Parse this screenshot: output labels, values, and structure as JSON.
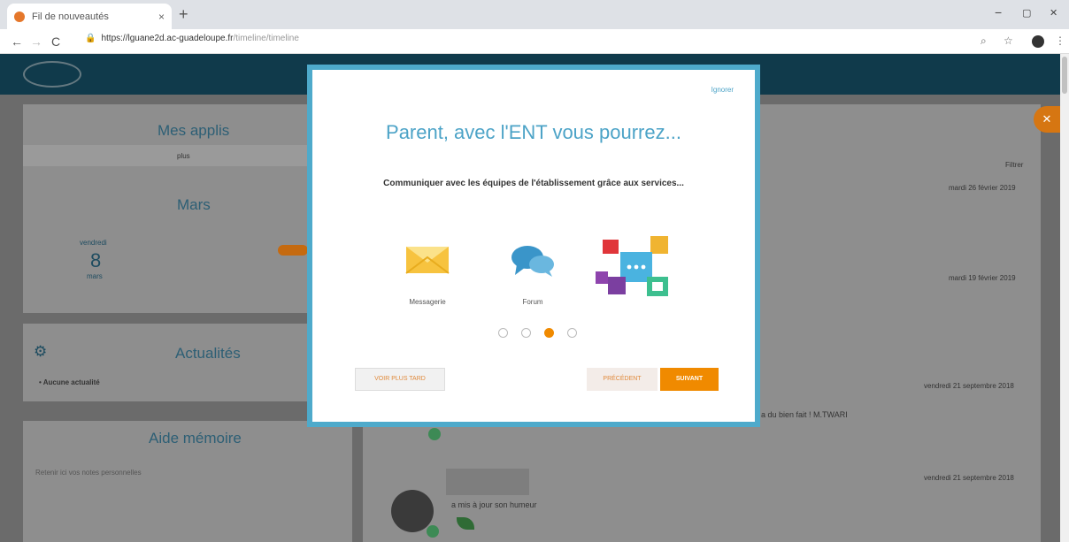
{
  "browser": {
    "tab_title": "Fil de nouveautés",
    "tab_close": "×",
    "new_tab": "+",
    "url_host": "https://lguane2d.ac-guadeloupe.fr",
    "url_path": "/timeline/timeline",
    "nav_back": "←",
    "nav_forward": "→",
    "nav_reload": "C",
    "win_min": "−",
    "win_max": "▢",
    "win_close": "✕"
  },
  "dashboard": {
    "mes_applis": "Mes applis",
    "plus": "plus",
    "calendar_month": "Mars",
    "day_name": "vendredi",
    "day_number": "8",
    "day_month": "mars",
    "actualites": "Actualités",
    "aucune": "• Aucune actualité",
    "aide_memoire": "Aide mémoire",
    "aide_placeholder": "Retenir ici vos notes personnelles",
    "timeline_date1": "mardi 26 février 2019",
    "timeline_date2": "mardi 19 février 2019",
    "timeline_date3": "vendredi 21 septembre 2018",
    "timeline_date4": "vendredi 21 septembre 2018",
    "timeline_text_tail": "a du bien fait ! M.TWARI",
    "timeline_text_humeur": "a mis à jour son humeur",
    "filter_label": "Filtrer"
  },
  "modal": {
    "ignore_label": "Ignorer",
    "title": "Parent, avec l'ENT vous pourrez...",
    "description": "Communiquer avec les équipes de l'établissement grâce aux services...",
    "services": [
      {
        "name": "Messagerie",
        "icon": "envelope-icon"
      },
      {
        "name": "Forum",
        "icon": "chat-bubbles-icon"
      },
      {
        "name": "",
        "icon": "apps-collage-icon"
      }
    ],
    "step_total": 4,
    "step_active": 3,
    "later_label": "VOIR PLUS TARD",
    "prev_label": "PRÉCÉDENT",
    "next_label": "SUIVANT"
  },
  "colors": {
    "header": "#1a5e7a",
    "modal_border": "#4eaacb",
    "accent": "#f08a00",
    "title_blue": "#4ca3c7"
  }
}
